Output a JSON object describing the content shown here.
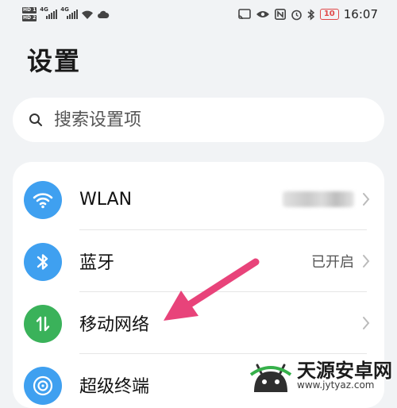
{
  "status_bar": {
    "sim1_label": "HD 1",
    "sim2_label": "HD 2",
    "net1": "4G",
    "net2": "4G",
    "battery": "10",
    "time": "16:07"
  },
  "page": {
    "title": "设置"
  },
  "search": {
    "placeholder": "搜索设置项"
  },
  "settings": {
    "items": [
      {
        "label": "WLAN",
        "value": "",
        "icon": "wifi-icon",
        "color": "#3fa0f0"
      },
      {
        "label": "蓝牙",
        "value": "已开启",
        "icon": "bluetooth-icon",
        "color": "#3fa0f0"
      },
      {
        "label": "移动网络",
        "value": "",
        "icon": "mobile-data-icon",
        "color": "#3ab25a"
      },
      {
        "label": "超级终端",
        "value": "",
        "icon": "super-device-icon",
        "color": "#3fa0f0"
      }
    ]
  },
  "annotation": {
    "arrow_color": "#e8437a"
  },
  "watermark": {
    "name": "天源安卓网",
    "url": "www.jytyaz.com"
  }
}
